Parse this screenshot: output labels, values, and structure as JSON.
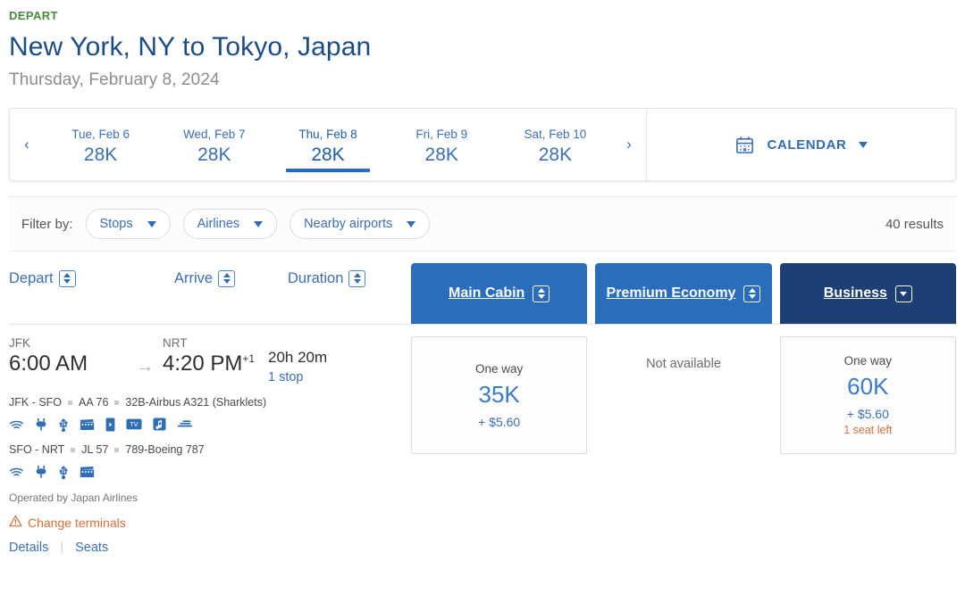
{
  "header": {
    "depart_label": "DEPART",
    "route_title": "New York, NY to Tokyo, Japan",
    "route_date": "Thursday, February 8, 2024"
  },
  "datestrip": {
    "prev_arrow": "‹",
    "next_arrow": "›",
    "dates": [
      {
        "day": "Tue, Feb 6",
        "price": "28K"
      },
      {
        "day": "Wed, Feb 7",
        "price": "28K"
      },
      {
        "day": "Thu, Feb 8",
        "price": "28K"
      },
      {
        "day": "Fri, Feb 9",
        "price": "28K"
      },
      {
        "day": "Sat, Feb 10",
        "price": "28K"
      }
    ],
    "selected_index": 2,
    "calendar_label": "CALENDAR"
  },
  "filterbar": {
    "label": "Filter by:",
    "filters": [
      {
        "label": "Stops"
      },
      {
        "label": "Airlines"
      },
      {
        "label": "Nearby airports"
      }
    ],
    "results": "40 results"
  },
  "sorts": [
    {
      "label": "Depart"
    },
    {
      "label": "Arrive"
    },
    {
      "label": "Duration"
    }
  ],
  "cabins": [
    {
      "label": "Main Cabin",
      "active": false,
      "sort_icon": "up-down"
    },
    {
      "label": "Premium Economy",
      "active": false,
      "sort_icon": "up-down"
    },
    {
      "label": "Business",
      "active": true,
      "sort_icon": "down"
    }
  ],
  "flight": {
    "depart": {
      "code": "JFK",
      "time": "6:00 AM",
      "day_offset": ""
    },
    "arrive": {
      "code": "NRT",
      "time": "4:20 PM",
      "day_offset": "+1"
    },
    "arrow": "→",
    "duration": "20h 20m",
    "stops": "1 stop",
    "segments": [
      {
        "route": "JFK - SFO",
        "flight_no": "AA 76",
        "aircraft": "32B-Airbus A321 (Sharklets)",
        "amenities": [
          "wifi-icon",
          "power-icon",
          "usb-icon",
          "movie-icon",
          "device-icon",
          "tv-icon",
          "music-icon",
          "seat-icon"
        ]
      },
      {
        "route": "SFO - NRT",
        "flight_no": "JL 57",
        "aircraft": "789-Boeing 787",
        "amenities": [
          "wifi-icon",
          "power-icon",
          "usb-icon",
          "movie-icon"
        ]
      }
    ],
    "operated_by": "Operated by Japan Airlines",
    "change_terminals": "Change terminals",
    "details_link": "Details",
    "seats_link": "Seats"
  },
  "fares": [
    {
      "available": true,
      "oneway_label": "One way",
      "price": "35K",
      "tax": "+ $5.60",
      "seats_left": ""
    },
    {
      "available": false,
      "unavailable_label": "Not available"
    },
    {
      "available": true,
      "oneway_label": "One way",
      "price": "60K",
      "tax": "+ $5.60",
      "seats_left": "1 seat left"
    }
  ],
  "colors": {
    "green": "#4a8a3d",
    "title_blue": "#1c4d82",
    "link_blue": "#3b6fb6",
    "cabin_blue": "#2a6ebb",
    "cabin_active": "#1c4074",
    "orange": "#d4703a"
  }
}
